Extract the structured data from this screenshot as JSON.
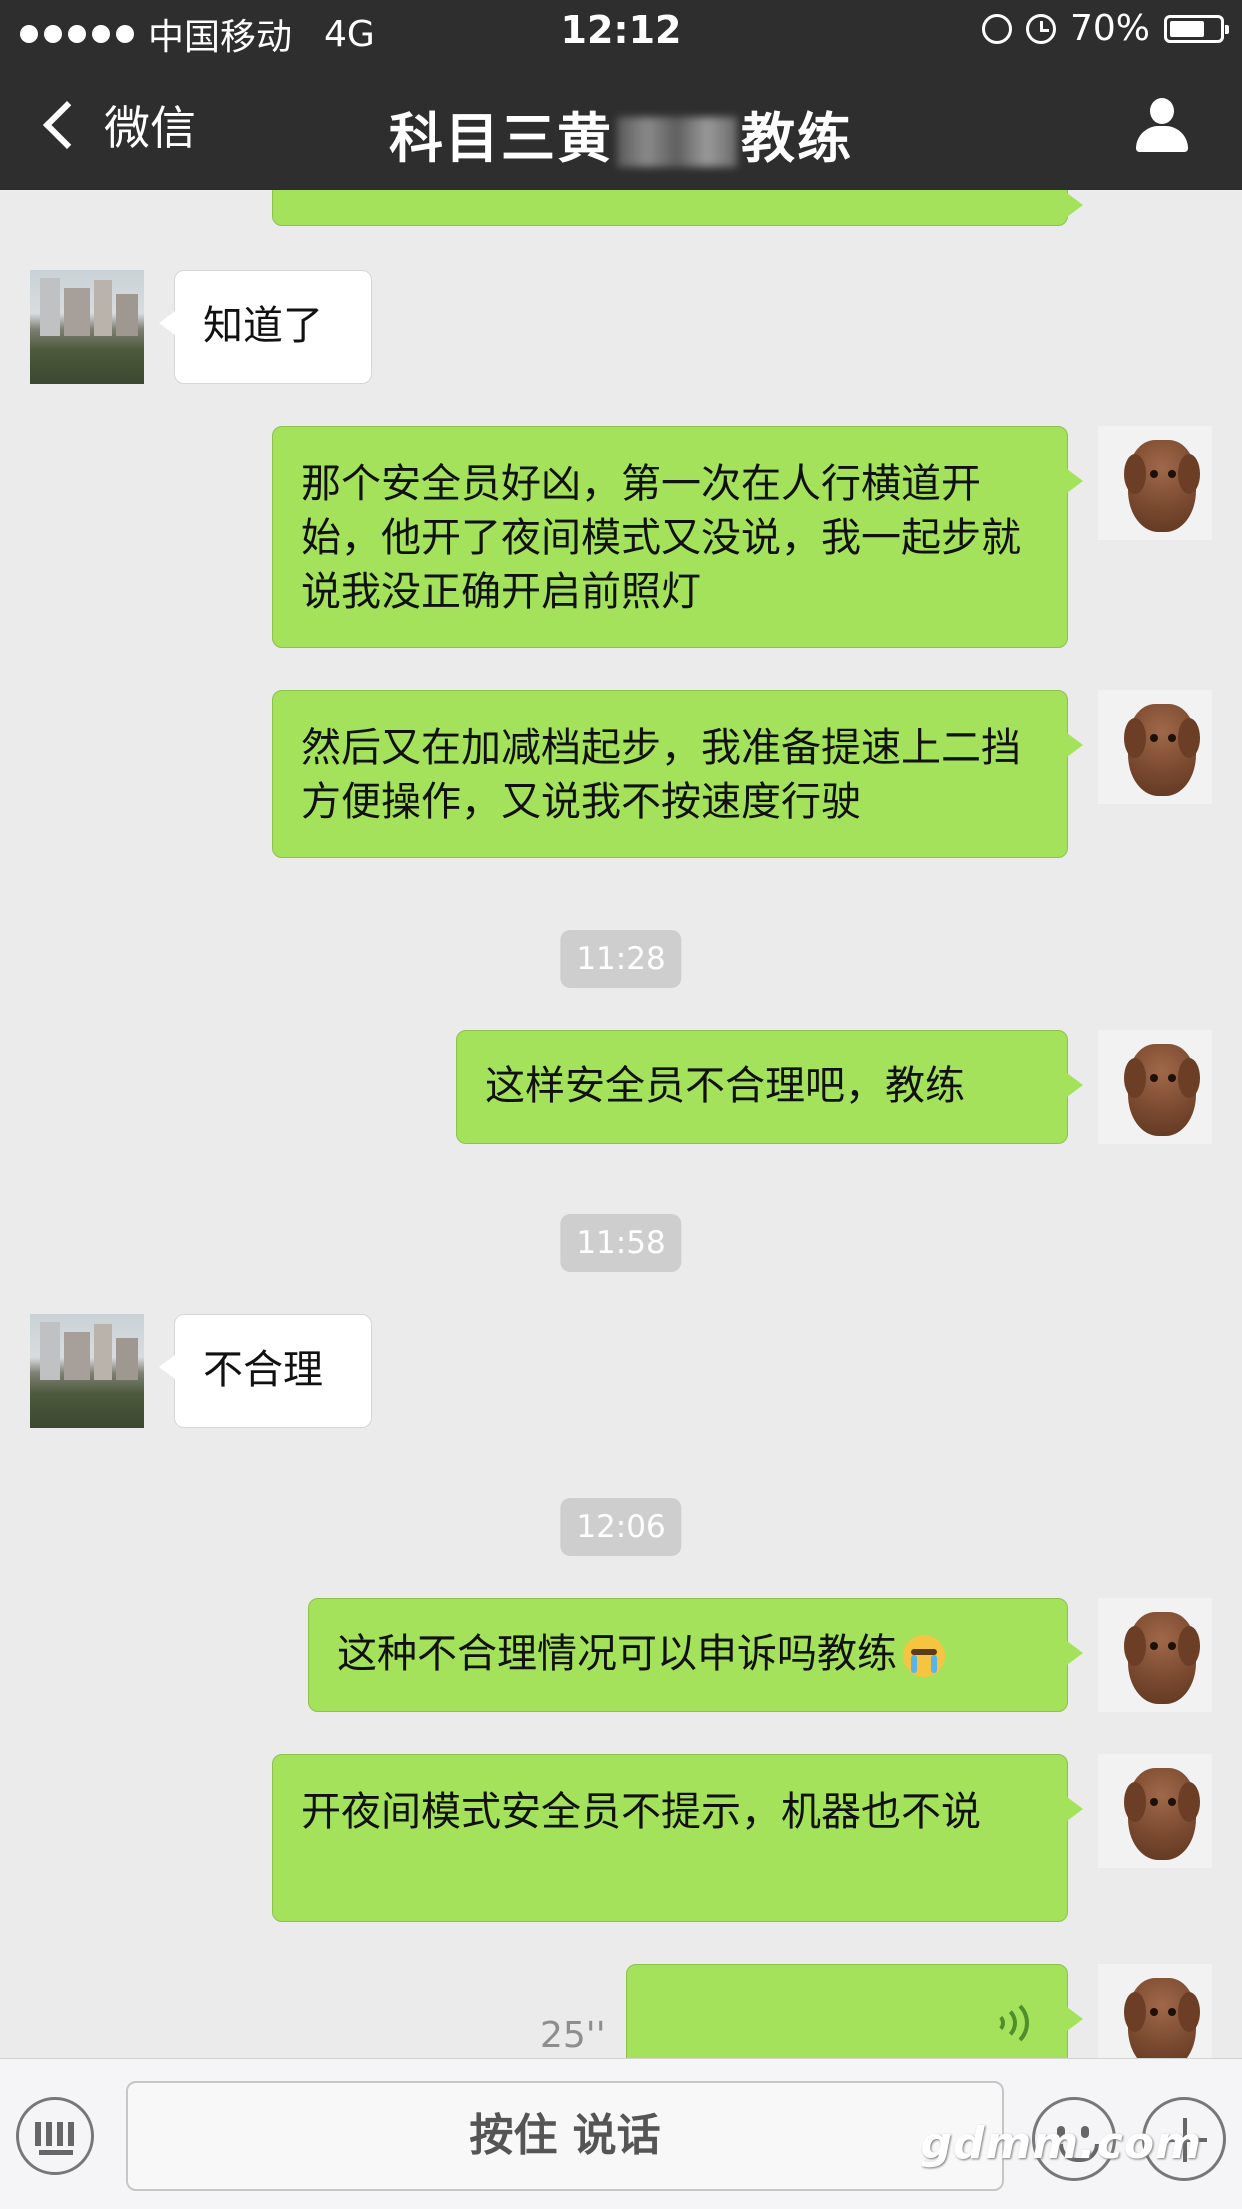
{
  "status": {
    "carrier": "中国移动",
    "network": "4G",
    "time": "12:12",
    "battery": "70%",
    "battery_level": 0.7
  },
  "nav": {
    "back_label": "微信",
    "title_left": "科目三黄",
    "title_right": "教练"
  },
  "messages": [
    {
      "from": "other",
      "text": "知道了"
    },
    {
      "from": "me",
      "text": "那个安全员好凶，第一次在人行横道开始，他开了夜间模式又没说，我一起步就说我没正确开启前照灯"
    },
    {
      "from": "me",
      "text": "然后又在加减档起步，我准备提速上二挡方便操作，又说我不按速度行驶"
    },
    {
      "time": "11:28"
    },
    {
      "from": "me",
      "text": "这样安全员不合理吧，教练"
    },
    {
      "time": "11:58"
    },
    {
      "from": "other",
      "text": "不合理"
    },
    {
      "time": "12:06"
    },
    {
      "from": "me",
      "text": "这种不合理情况可以申诉吗教练",
      "emoji": "crying-face-icon"
    },
    {
      "from": "me",
      "text": "开夜间模式安全员不提示，机器也不说"
    },
    {
      "from": "me",
      "type": "voice",
      "duration": "25''"
    }
  ],
  "input_bar": {
    "hold_to_talk_label": "按住 说话"
  },
  "watermark": "gdmm.com",
  "colors": {
    "nav_bg": "#2e2e2e",
    "chat_bg": "#ebebeb",
    "my_bubble": "#a4e25c",
    "other_bubble": "#ffffff",
    "time_pill": "#cecece"
  }
}
